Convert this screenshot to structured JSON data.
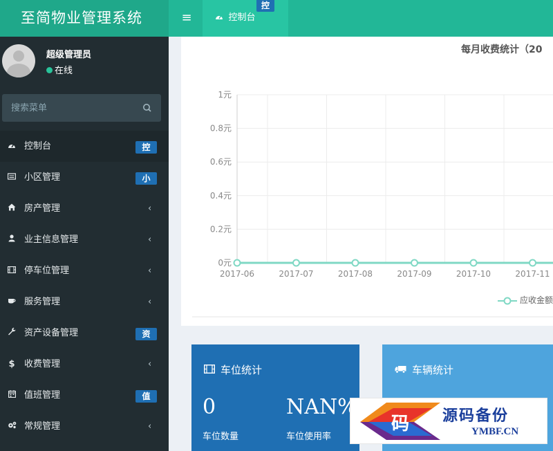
{
  "app": {
    "title": "至简物业管理系统"
  },
  "header": {
    "toggle_glyph": "≡",
    "tab": {
      "icon": "dashboard-icon",
      "label": "控制台",
      "badge": "控"
    }
  },
  "user": {
    "name": "超级管理员",
    "status": "在线"
  },
  "search": {
    "placeholder": "搜索菜单"
  },
  "sidebar": {
    "items": [
      {
        "icon": "dashboard-icon",
        "label": "控制台",
        "badge": "控",
        "active": true
      },
      {
        "icon": "list-icon",
        "label": "小区管理",
        "badge": "小"
      },
      {
        "icon": "home-icon",
        "label": "房产管理",
        "chevron": "‹"
      },
      {
        "icon": "user-icon",
        "label": "业主信息管理",
        "chevron": "‹"
      },
      {
        "icon": "film-icon",
        "label": "停车位管理",
        "chevron": "‹"
      },
      {
        "icon": "coffee-icon",
        "label": "服务管理",
        "chevron": "‹"
      },
      {
        "icon": "wrench-icon",
        "label": "资产设备管理",
        "badge": "资"
      },
      {
        "icon": "dollar-icon",
        "label": "收费管理",
        "chevron": "‹"
      },
      {
        "icon": "calendar-icon",
        "label": "值班管理",
        "badge": "值"
      },
      {
        "icon": "gears-icon",
        "label": "常规管理",
        "chevron": "‹"
      }
    ]
  },
  "chart_data": {
    "type": "line",
    "title": "每月收费统计（20",
    "x": [
      "2017-06",
      "2017-07",
      "2017-08",
      "2017-09",
      "2017-10",
      "2017-11"
    ],
    "yticks": [
      "0元",
      "0.2元",
      "0.4元",
      "0.6元",
      "0.8元",
      "1元"
    ],
    "ylim": [
      0,
      1
    ],
    "series": [
      {
        "name": "应收金额",
        "values": [
          0,
          0,
          0,
          0,
          0,
          0
        ],
        "color": "#7fd8c4"
      }
    ],
    "legend_placement": "bottom-right",
    "grid": true
  },
  "cards": {
    "parking": {
      "title": "车位统计",
      "icon": "film-icon",
      "count_value": "0",
      "count_label": "车位数量",
      "usage_value": "NAN%",
      "usage_label": "车位使用率",
      "color": "#1f6fb3"
    },
    "vehicle": {
      "title": "车辆统计",
      "icon": "truck-icon",
      "color": "#4ea4dd"
    }
  },
  "watermark": {
    "logo_char": "码",
    "name": "源码备份",
    "url": "YMBF.CN"
  }
}
